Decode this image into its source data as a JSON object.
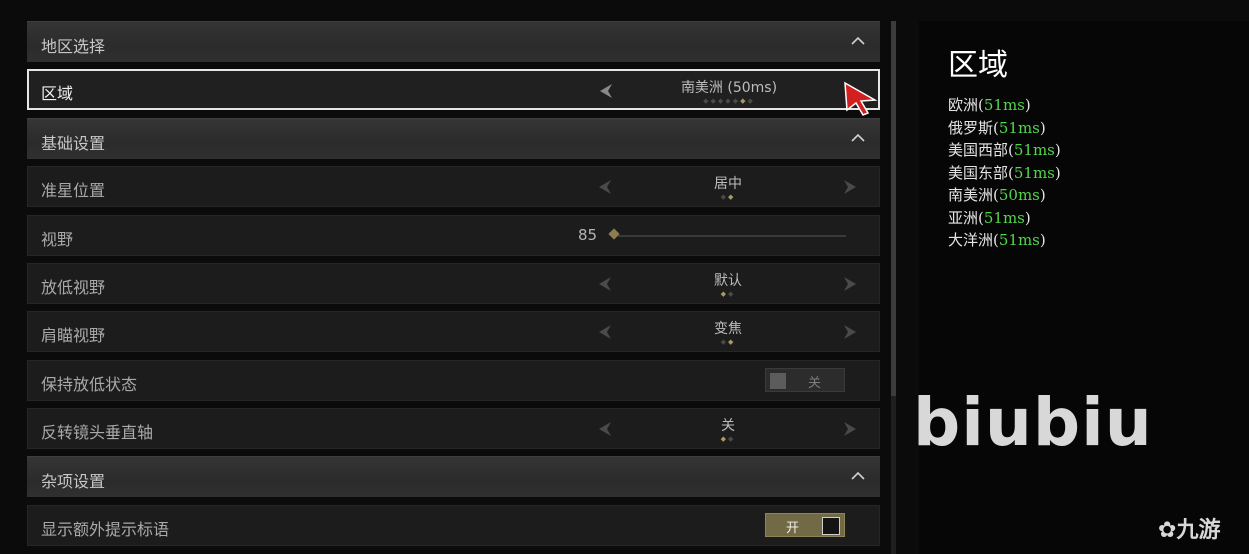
{
  "settings": {
    "region_section": {
      "title": "地区选择",
      "region_row": {
        "label": "区域",
        "value": "南美洲 (50ms)",
        "option_count": 7,
        "selected_index": 5
      }
    },
    "basic_section": {
      "title": "基础设置",
      "crosshair": {
        "label": "准星位置",
        "value": "居中",
        "option_count": 2,
        "selected_index": 1
      },
      "fov": {
        "label": "视野",
        "value": "85",
        "fill": 0.0
      },
      "ads_fov": {
        "label": "放低视野",
        "value": "默认",
        "option_count": 2,
        "selected_index": 0
      },
      "shoulder_fov": {
        "label": "肩瞄视野",
        "value": "变焦",
        "option_count": 2,
        "selected_index": 1
      },
      "hold_ads": {
        "label": "保持放低状态",
        "state": "关"
      },
      "invert_y": {
        "label": "反转镜头垂直轴",
        "value": "关",
        "option_count": 2,
        "selected_index": 0
      }
    },
    "misc_section": {
      "title": "杂项设置",
      "extra_hints": {
        "label": "显示额外提示标语",
        "state": "开"
      }
    }
  },
  "info_panel": {
    "title": "区域",
    "regions": [
      {
        "name": "欧洲",
        "ping": "51ms"
      },
      {
        "name": "俄罗斯",
        "ping": "51ms"
      },
      {
        "name": "美国西部",
        "ping": "51ms"
      },
      {
        "name": "美国东部",
        "ping": "51ms"
      },
      {
        "name": "南美洲",
        "ping": "50ms"
      },
      {
        "name": "亚洲",
        "ping": "51ms"
      },
      {
        "name": "大洋洲",
        "ping": "51ms"
      }
    ]
  },
  "watermark": "biubiu",
  "logo": "九游",
  "colors": {
    "accent_gold": "#a89a64",
    "ping_green": "#52d64b",
    "selected_border": "#e6e6e6"
  },
  "icons": [
    "chevron-up-icon",
    "arrow-left-icon",
    "arrow-right-icon",
    "mouse-cursor-icon"
  ]
}
